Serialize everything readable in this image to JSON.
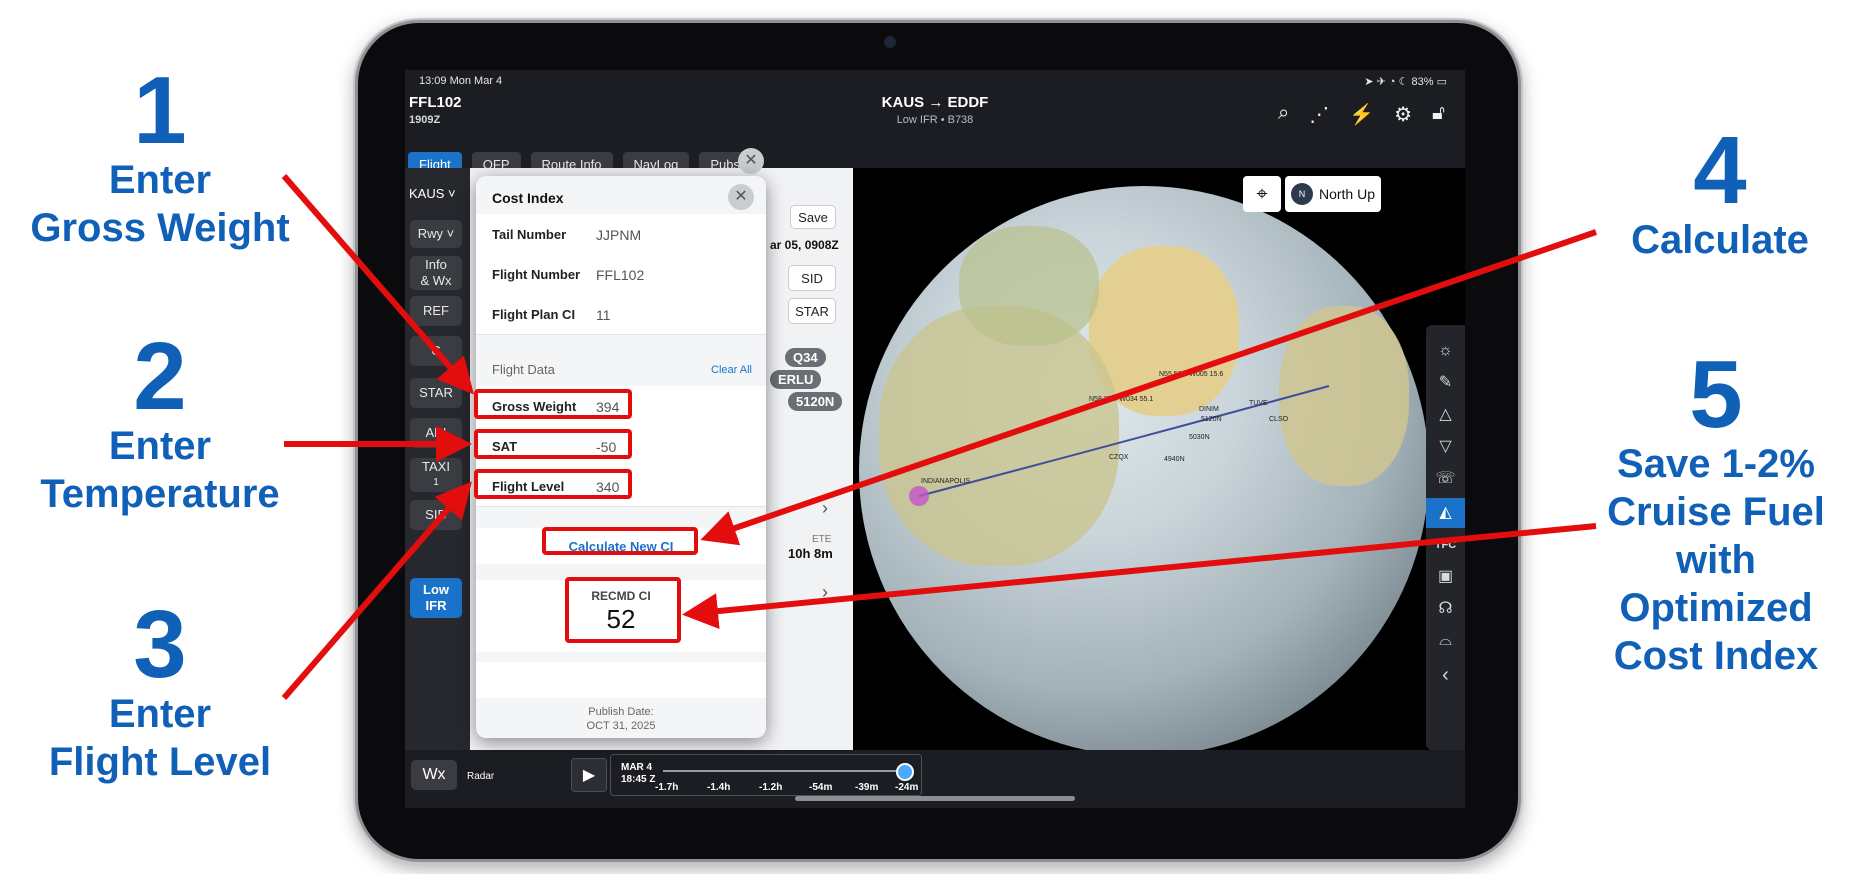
{
  "annotations": [
    {
      "number": "1",
      "lines": [
        "Enter",
        "Gross Weight"
      ]
    },
    {
      "number": "2",
      "lines": [
        "Enter",
        "Temperature"
      ]
    },
    {
      "number": "3",
      "lines": [
        "Enter",
        "Flight Level"
      ]
    },
    {
      "number": "4",
      "lines": [
        "Calculate"
      ]
    },
    {
      "number": "5",
      "lines": [
        "Save 1-2%",
        "Cruise Fuel",
        "with",
        "Optimized",
        "Cost Index"
      ]
    }
  ],
  "status_bar": {
    "time": "13:09  Mon Mar 4",
    "battery": "83%"
  },
  "header": {
    "flight_id": "FFL102",
    "time": "1909Z",
    "route": "KAUS → EDDF",
    "subtitle": "Low IFR • B738"
  },
  "tabs": [
    {
      "label": "Flight",
      "active": true
    },
    {
      "label": "OFP"
    },
    {
      "label": "Route Info"
    },
    {
      "label": "NavLog"
    },
    {
      "label": "Pubs"
    }
  ],
  "left_column": {
    "departure": "KAUS",
    "buttons": [
      "Rwy",
      "Info\n& Wx",
      "REF",
      "C",
      "STAR",
      "API",
      "TAXI",
      "SID"
    ],
    "taxi_sub": "1",
    "chart_type": "Low\nIFR"
  },
  "flight_panel": {
    "save_label": "Save",
    "date_text": "ar 05, 0908Z",
    "sid_label": "SID",
    "star_label": "STAR",
    "chips": [
      "Q34",
      "ERLU",
      "5120N"
    ],
    "ete_label": "ETE",
    "ete_value": "10h 8m"
  },
  "cost_index": {
    "title": "Cost Index",
    "tail_number_label": "Tail Number",
    "tail_number": "JJPNM",
    "flight_number_label": "Flight Number",
    "flight_number": "FFL102",
    "flight_plan_ci_label": "Flight Plan CI",
    "flight_plan_ci": "11",
    "flight_data_label": "Flight Data",
    "clear_all_label": "Clear All",
    "gross_weight_label": "Gross Weight",
    "gross_weight": "394",
    "sat_label": "SAT",
    "sat": "-50",
    "flight_level_label": "Flight Level",
    "flight_level": "340",
    "calculate_label": "Calculate New CI",
    "recmd_label": "RECMD CI",
    "recmd_value": "52",
    "publish_label": "Publish Date:",
    "publish_date": "OCT 31, 2025"
  },
  "map": {
    "orientation_label": "North Up",
    "compass_letter": "N",
    "waypoints": [
      "N55 56.3 W005 15.6",
      "N58 37.7 W034 55.1",
      "DINIM",
      "5120N",
      "TUVE",
      "CLSO",
      "5030N",
      "4940N",
      "CZQX",
      "INDIANAPOLIS"
    ]
  },
  "right_rail": {
    "traffic_label": "TFC"
  },
  "bottom_bar": {
    "wx_label": "Wx",
    "radar_label": "Radar",
    "date_label": "MAR 4",
    "time_label": "18:45 Z",
    "ticks": [
      "-1.7h",
      "-1.4h",
      "-1.2h",
      "-54m",
      "-39m",
      "-24m"
    ]
  },
  "colors": {
    "annotation_blue": "#1160b8",
    "highlight_red": "#e40d0d",
    "app_accent": "#1a73c9"
  }
}
